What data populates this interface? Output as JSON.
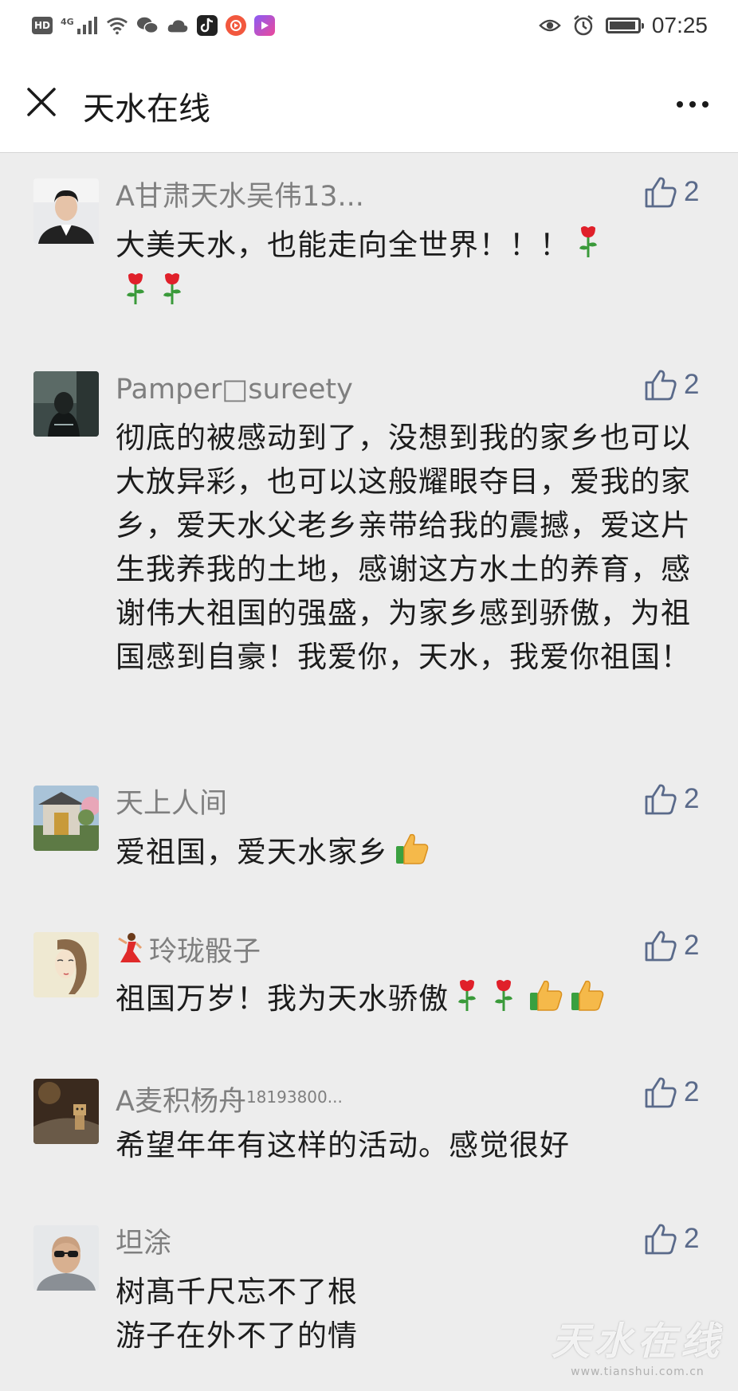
{
  "status_bar": {
    "hd": "HD",
    "network": "4G",
    "time": "07:25",
    "battery_level": 0.95
  },
  "nav": {
    "title": "天水在线"
  },
  "comments": [
    {
      "name": "A甘肃天水吴伟13...",
      "text": "大美天水，也能走向全世界！！！",
      "likes": "2"
    },
    {
      "name": "Pamper□sureety",
      "text": "彻底的被感动到了，没想到我的家乡也可以大放异彩，也可以这般耀眼夺目，爱我的家乡，爱天水父老乡亲带给我的震撼，爱这片生我养我的土地，感谢这方水土的养育，感谢伟大祖国的强盛，为家乡感到骄傲，为祖国感到自豪！我爱你，天水，我爱你祖国！",
      "likes": "2"
    },
    {
      "name": "天上人间",
      "text": "爱祖国，爱天水家乡",
      "likes": "2"
    },
    {
      "name": "玲珑骰子",
      "text": "祖国万岁！我为天水骄傲",
      "likes": "2"
    },
    {
      "name": "A麦积杨舟",
      "name_suffix": "18193800...",
      "text": "希望年年有这样的活动。感觉很好",
      "likes": "2"
    },
    {
      "name": "坦涂",
      "text": "树髙千尺忘不了根",
      "text2": "游子在外不了的情",
      "likes": "2"
    }
  ],
  "watermark": {
    "title": "天水在线",
    "url": "www.tianshui.com.cn"
  }
}
